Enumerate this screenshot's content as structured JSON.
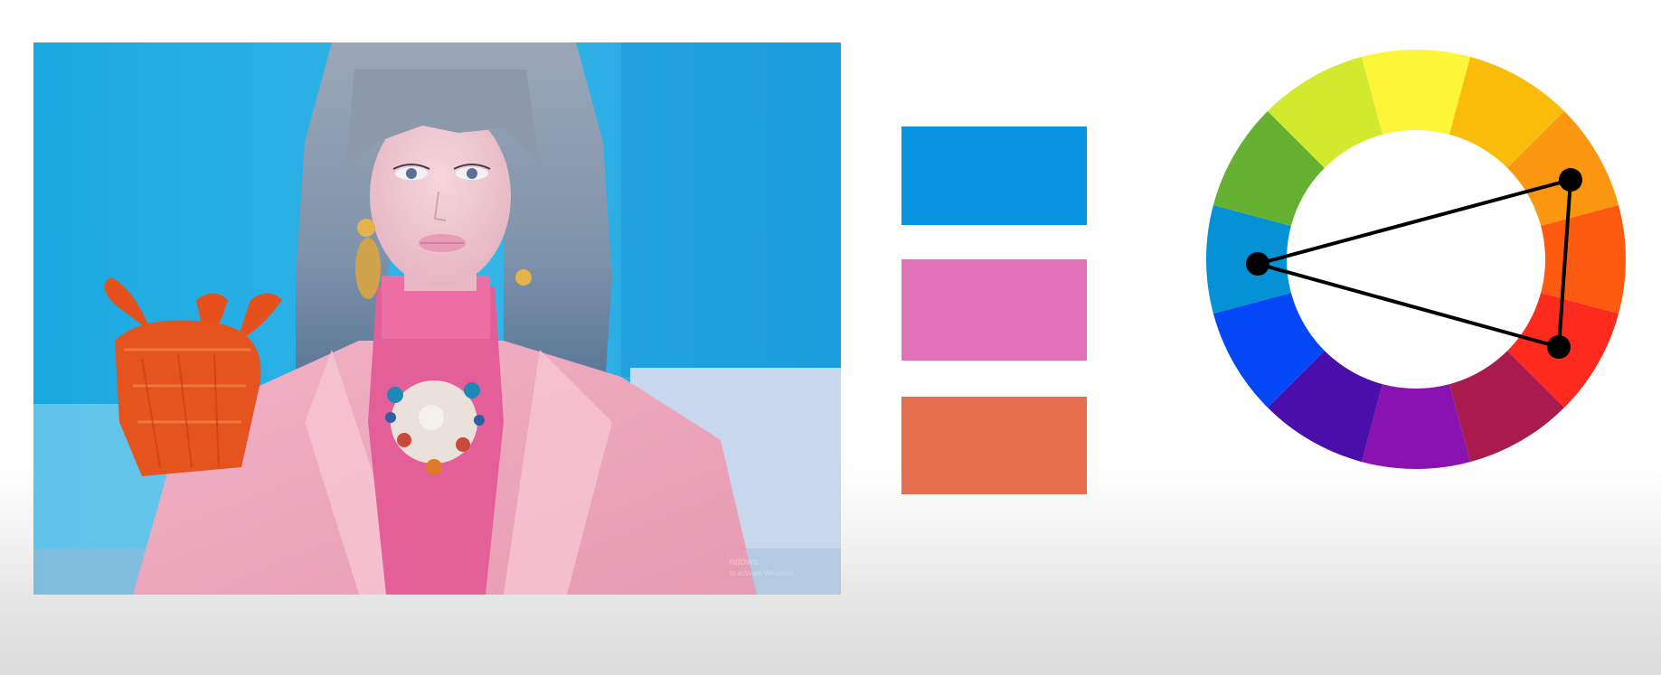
{
  "photo": {
    "subject": "photo",
    "watermark_title": "ndows",
    "watermark_sub": "to activate Windows."
  },
  "swatches": [
    {
      "name": "blue",
      "color": "#0894e2"
    },
    {
      "name": "pink",
      "color": "#e073b8"
    },
    {
      "name": "orange",
      "color": "#e76d4f"
    }
  ],
  "color_wheel": {
    "segments": [
      "#fdf537",
      "#f9bc0b",
      "#fb9610",
      "#fd5a11",
      "#fe2a1d",
      "#a81b4c",
      "#8a12b1",
      "#4a0fab",
      "#0447f6",
      "#0592d5",
      "#66b032",
      "#d2ea2e"
    ],
    "triad": [
      "blue",
      "orange",
      "red-orange"
    ],
    "line_color": "#000000"
  }
}
